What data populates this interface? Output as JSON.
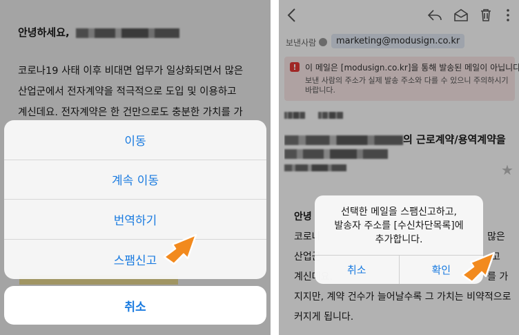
{
  "left": {
    "greeting": "안녕하세요,",
    "paragraph": [
      "코로나19 사태 이후 비대면 업무가 일상화되면서 많은",
      "산업군에서 전자계약을 적극적으로 도입 및 이용하고",
      "계신데요. 전자계약은 한 건만으로도 충분한 가치를 가"
    ],
    "actions": {
      "move": "이동",
      "continue_move": "계속 이동",
      "translate": "번역하기",
      "report_spam": "스팸신고"
    },
    "cancel": "취소"
  },
  "right": {
    "sender_label": "보낸사람",
    "sender_address": "marketing@modusign.co.kr",
    "warning_title": "이 메일은 [modusign.co.kr]을 통해 발송된 메일이 아닙니다.",
    "warning_detail": "보낸 사람의 주소가 실제 발송 주소와 다를 수 있으니 주의하시기 바랍니다.",
    "subject_line1_tail": "의 근로계약/용역계약을",
    "body_greeting": "안녕",
    "body_lines": [
      "코로나",
      "산업군",
      "계신데요.",
      "지지만, 계약 건수가 늘어날수록 그 가치는 비약적으로",
      "커지게 됩니다."
    ],
    "body_tails": [
      "많은",
      "고",
      "를 가"
    ],
    "alert": {
      "line1": "선택한 메일을 스팸신고하고,",
      "line2": "발송자 주소를 [수신차단목록]에",
      "line3": "추가합니다.",
      "cancel": "취소",
      "confirm": "확인"
    }
  },
  "colors": {
    "ios_blue": "#1a7be0",
    "arrow_orange": "#f28a1e",
    "warning_red": "#e53935",
    "warning_bg": "#fbe9e9",
    "chip_bg": "#e3eaf5"
  }
}
